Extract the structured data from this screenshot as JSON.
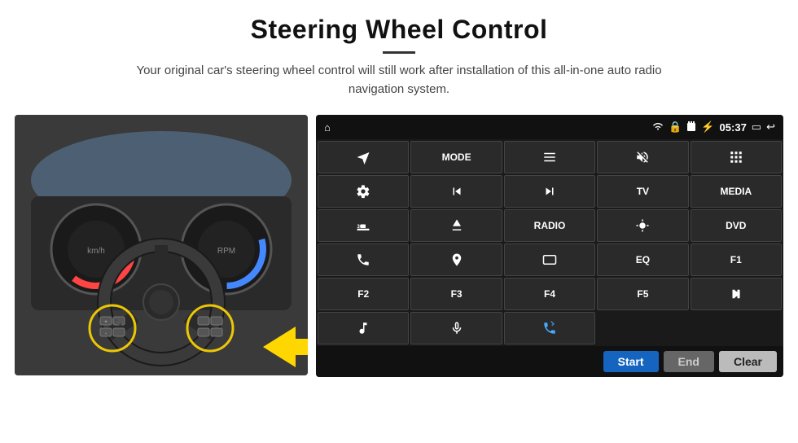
{
  "header": {
    "title": "Steering Wheel Control",
    "subtitle": "Your original car's steering wheel control will still work after installation of this all-in-one auto radio navigation system."
  },
  "status_bar": {
    "time": "05:37",
    "icons": [
      "home",
      "wifi",
      "lock",
      "sd-card",
      "bluetooth",
      "cast",
      "back"
    ]
  },
  "button_grid": [
    {
      "id": "row1-1",
      "type": "icon",
      "icon": "navigate",
      "label": ""
    },
    {
      "id": "row1-2",
      "type": "text",
      "label": "MODE"
    },
    {
      "id": "row1-3",
      "type": "icon",
      "icon": "list",
      "label": ""
    },
    {
      "id": "row1-4",
      "type": "icon",
      "icon": "mute",
      "label": ""
    },
    {
      "id": "row1-5",
      "type": "icon",
      "icon": "apps",
      "label": ""
    },
    {
      "id": "row2-1",
      "type": "icon",
      "icon": "settings",
      "label": ""
    },
    {
      "id": "row2-2",
      "type": "icon",
      "icon": "prev",
      "label": ""
    },
    {
      "id": "row2-3",
      "type": "icon",
      "icon": "next",
      "label": ""
    },
    {
      "id": "row2-4",
      "type": "text",
      "label": "TV"
    },
    {
      "id": "row2-5",
      "type": "text",
      "label": "MEDIA"
    },
    {
      "id": "row3-1",
      "type": "icon",
      "icon": "360-cam",
      "label": ""
    },
    {
      "id": "row3-2",
      "type": "icon",
      "icon": "eject",
      "label": ""
    },
    {
      "id": "row3-3",
      "type": "text",
      "label": "RADIO"
    },
    {
      "id": "row3-4",
      "type": "icon",
      "icon": "brightness",
      "label": ""
    },
    {
      "id": "row3-5",
      "type": "text",
      "label": "DVD"
    },
    {
      "id": "row4-1",
      "type": "icon",
      "icon": "phone",
      "label": ""
    },
    {
      "id": "row4-2",
      "type": "icon",
      "icon": "navi",
      "label": ""
    },
    {
      "id": "row4-3",
      "type": "icon",
      "icon": "screen",
      "label": ""
    },
    {
      "id": "row4-4",
      "type": "text",
      "label": "EQ"
    },
    {
      "id": "row4-5",
      "type": "text",
      "label": "F1"
    },
    {
      "id": "row5-1",
      "type": "text",
      "label": "F2"
    },
    {
      "id": "row5-2",
      "type": "text",
      "label": "F3"
    },
    {
      "id": "row5-3",
      "type": "text",
      "label": "F4"
    },
    {
      "id": "row5-4",
      "type": "text",
      "label": "F5"
    },
    {
      "id": "row5-5",
      "type": "icon",
      "icon": "play-pause",
      "label": ""
    },
    {
      "id": "row6-1",
      "type": "icon",
      "icon": "music",
      "label": ""
    },
    {
      "id": "row6-2",
      "type": "icon",
      "icon": "mic",
      "label": ""
    },
    {
      "id": "row6-3",
      "type": "icon",
      "icon": "phone-answer",
      "label": ""
    }
  ],
  "bottom_buttons": {
    "start": "Start",
    "end": "End",
    "clear": "Clear"
  }
}
